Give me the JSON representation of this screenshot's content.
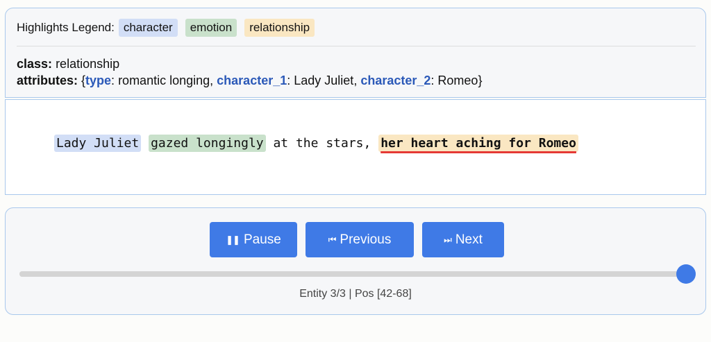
{
  "legend": {
    "label": "Highlights Legend:",
    "chips": [
      "character",
      "emotion",
      "relationship"
    ]
  },
  "entity": {
    "class_key": "class:",
    "class_value": "relationship",
    "attributes_key": "attributes:",
    "attr_open": " {",
    "attr_close": "}",
    "attributes": [
      {
        "key": "type",
        "value": "romantic longing"
      },
      {
        "key": "character_1",
        "value": "Lady Juliet"
      },
      {
        "key": "character_2",
        "value": "Romeo"
      }
    ]
  },
  "sentence": {
    "character": "Lady Juliet",
    "emotion": "gazed longingly",
    "plain": " at the stars, ",
    "relationship": "her heart aching for Romeo"
  },
  "controls": {
    "pause_label": "Pause",
    "previous_label": "Previous",
    "next_label": "Next",
    "pause_icon": "pause-icon",
    "previous_icon": "skip-previous-icon",
    "next_icon": "skip-next-icon",
    "progress": 1.0,
    "status": "Entity 3/3 | Pos [42-68]"
  },
  "colors": {
    "accent": "#3f7ae6",
    "character": "#d2def6",
    "emotion": "#c9e1cb",
    "relationship": "#fae7c2",
    "attr_key": "#2b59b8",
    "underline": "#e53935"
  }
}
